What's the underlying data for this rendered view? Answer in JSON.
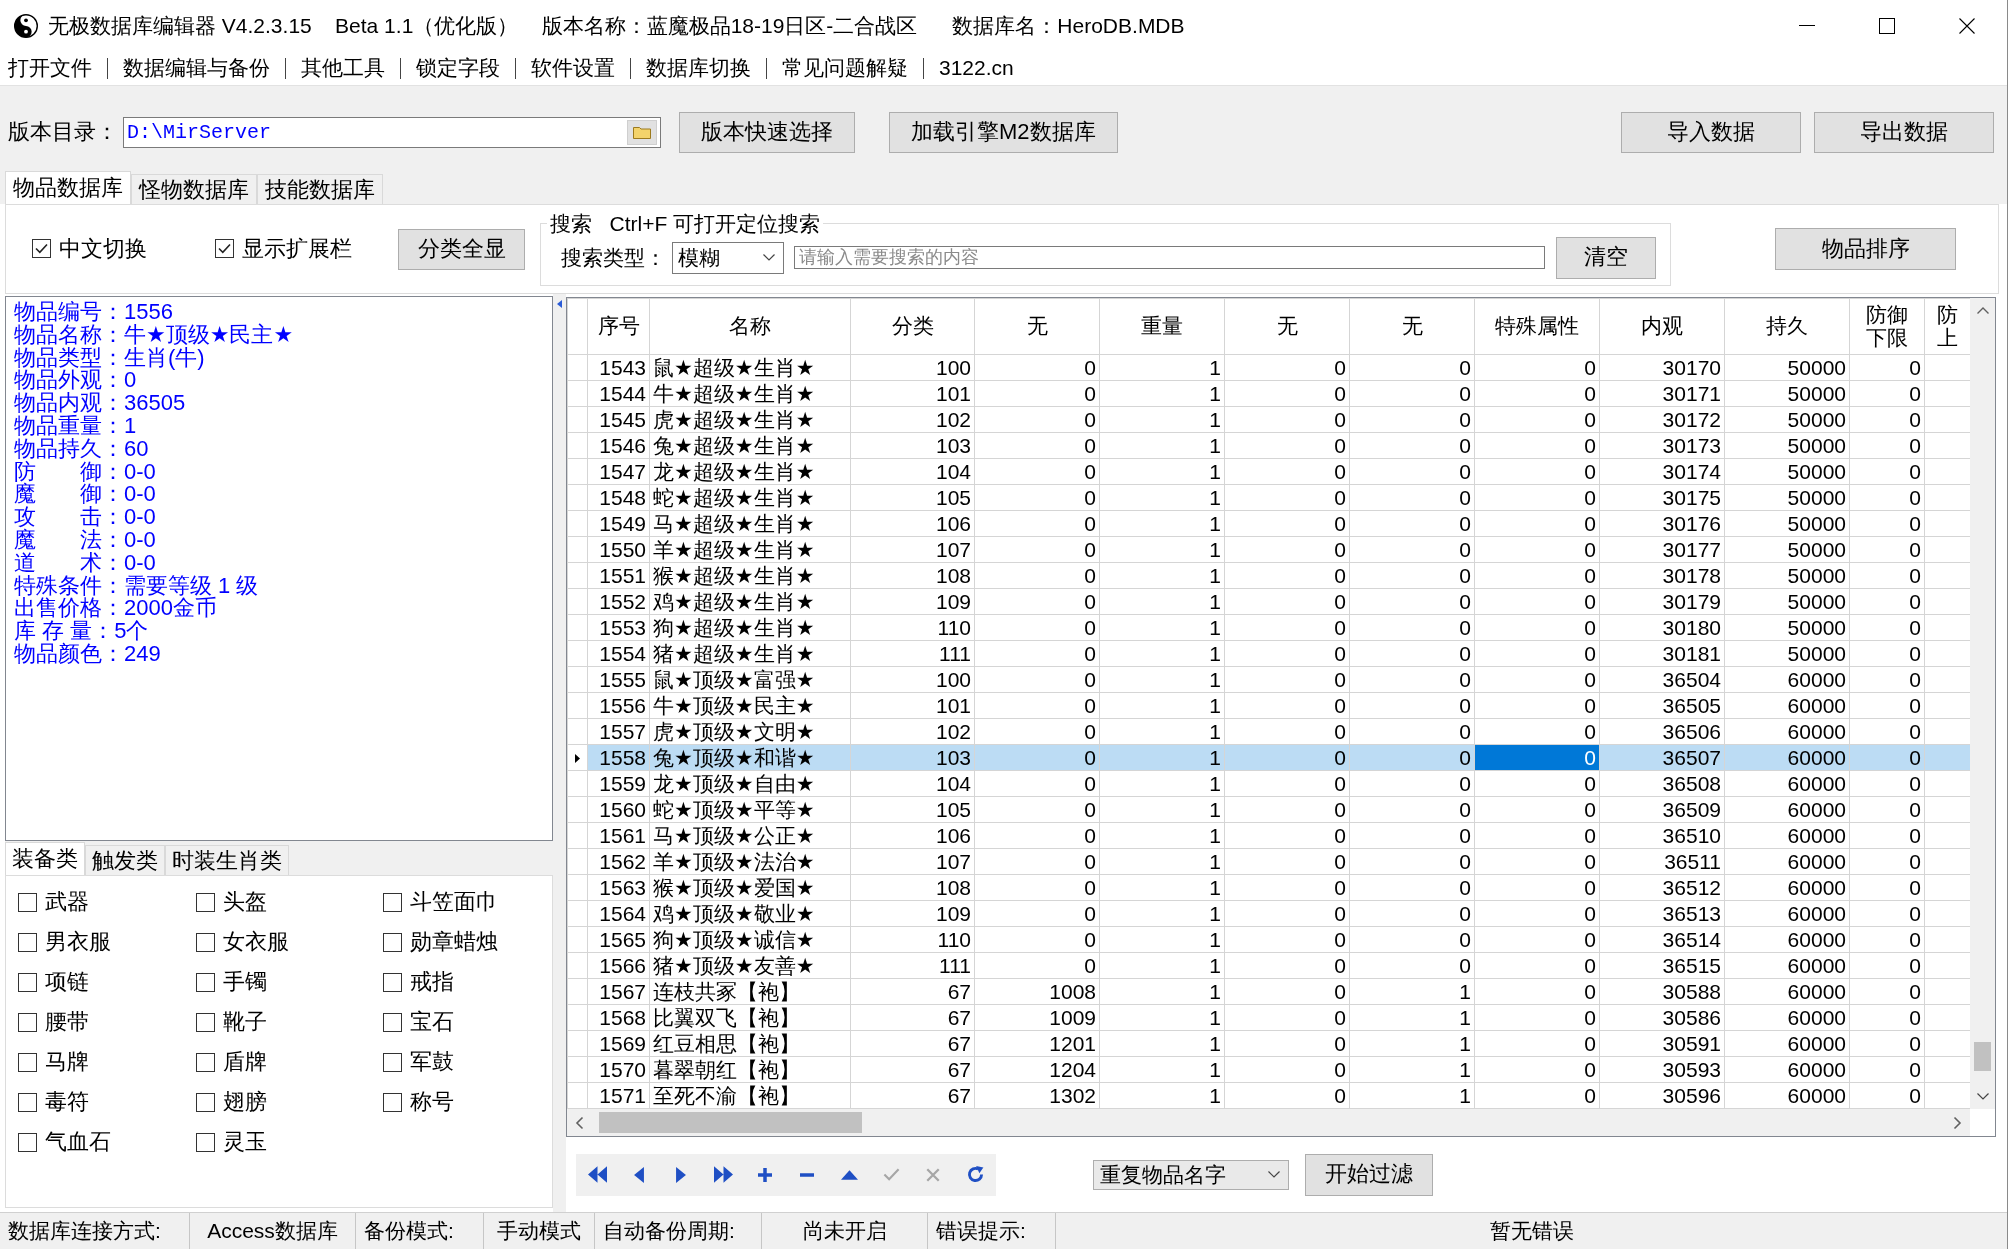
{
  "window": {
    "title": "无极数据库编辑器 V4.2.3.15    Beta 1.1（优化版）    版本名称：蓝魔极品18-19日区-二合战区      数据库名：HeroDB.MDB"
  },
  "menu": [
    "打开文件",
    "数据编辑与备份",
    "其他工具",
    "锁定字段",
    "软件设置",
    "数据库切换",
    "常见问题解疑",
    "3122.cn"
  ],
  "toolbar": {
    "path_label": "版本目录：",
    "path": "D:\\MirServer",
    "left_buttons": [
      "版本快速选择",
      "加载引擎M2数据库"
    ],
    "right_buttons": [
      "导入数据",
      "导出数据"
    ]
  },
  "tabs": [
    {
      "label": "物品数据库",
      "selected": true
    },
    {
      "label": "怪物数据库",
      "selected": false
    },
    {
      "label": "技能数据库",
      "selected": false
    }
  ],
  "options": {
    "checkboxes": [
      {
        "label": "中文切换",
        "checked": true
      },
      {
        "label": "显示扩展栏",
        "checked": true
      }
    ],
    "show_all_button": "分类全显"
  },
  "search": {
    "legend": "搜索   Ctrl+F 可打开定位搜索",
    "type_label": "搜索类型：",
    "type": "模糊",
    "placeholder": "请输入需要搜索的内容",
    "clear_button": "清空"
  },
  "sort_button": "物品排序",
  "details": [
    "物品编号：1556",
    "物品名称：牛★顶级★民主★",
    "物品类型：生肖(牛)",
    "物品外观：0",
    "物品内观：36505",
    "物品重量：1",
    "物品持久：60",
    "防　　御：0-0",
    "魔　　御：0-0",
    "攻　　击：0-0",
    "魔　　法：0-0",
    "道　　术：0-0",
    "特殊条件：需要等级 1 级",
    "出售价格：2000金币",
    "库 存 量：5个",
    "物品颜色：249"
  ],
  "category_tabs": [
    {
      "label": "装备类",
      "selected": true
    },
    {
      "label": "触发类",
      "selected": false
    },
    {
      "label": "时装生肖类",
      "selected": false
    }
  ],
  "categories": [
    {
      "label": "武器",
      "checked": false
    },
    {
      "label": "头盔",
      "checked": false
    },
    {
      "label": "斗笠面巾",
      "checked": false
    },
    {
      "label": "男衣服",
      "checked": false
    },
    {
      "label": "女衣服",
      "checked": false
    },
    {
      "label": "勋章蜡烛",
      "checked": false
    },
    {
      "label": "项链",
      "checked": false
    },
    {
      "label": "手镯",
      "checked": false
    },
    {
      "label": "戒指",
      "checked": false
    },
    {
      "label": "腰带",
      "checked": false
    },
    {
      "label": "靴子",
      "checked": false
    },
    {
      "label": "宝石",
      "checked": false
    },
    {
      "label": "马牌",
      "checked": false
    },
    {
      "label": "盾牌",
      "checked": false
    },
    {
      "label": "军鼓",
      "checked": false
    },
    {
      "label": "毒符",
      "checked": false
    },
    {
      "label": "翅膀",
      "checked": false
    },
    {
      "label": "称号",
      "checked": false
    },
    {
      "label": "气血石",
      "checked": false
    },
    {
      "label": "灵玉",
      "checked": false
    }
  ],
  "table": {
    "columns": [
      {
        "label": "序号",
        "kind": "number",
        "focused": false
      },
      {
        "label": "名称",
        "kind": "text",
        "focused": false
      },
      {
        "label": "分类",
        "kind": "number",
        "focused": false
      },
      {
        "label": "无",
        "kind": "number",
        "focused": false
      },
      {
        "label": "重量",
        "kind": "number",
        "focused": false
      },
      {
        "label": "无",
        "kind": "number",
        "focused": false
      },
      {
        "label": "无",
        "kind": "number",
        "focused": false
      },
      {
        "label": "特殊属性",
        "kind": "number",
        "focused": true
      },
      {
        "label": "内观",
        "kind": "number",
        "focused": false
      },
      {
        "label": "持久",
        "kind": "number",
        "focused": false
      },
      {
        "label": "防御下限",
        "kind": "number",
        "focused": false
      },
      {
        "label": "防上",
        "focused": false
      }
    ],
    "rows": [
      {
        "cells": [
          "1543",
          "鼠★超级★生肖★",
          "100",
          "0",
          "1",
          "0",
          "0",
          "0",
          "30170",
          "50000",
          "0"
        ],
        "selected": false
      },
      {
        "cells": [
          "1544",
          "牛★超级★生肖★",
          "101",
          "0",
          "1",
          "0",
          "0",
          "0",
          "30171",
          "50000",
          "0"
        ],
        "selected": false
      },
      {
        "cells": [
          "1545",
          "虎★超级★生肖★",
          "102",
          "0",
          "1",
          "0",
          "0",
          "0",
          "30172",
          "50000",
          "0"
        ],
        "selected": false
      },
      {
        "cells": [
          "1546",
          "兔★超级★生肖★",
          "103",
          "0",
          "1",
          "0",
          "0",
          "0",
          "30173",
          "50000",
          "0"
        ],
        "selected": false
      },
      {
        "cells": [
          "1547",
          "龙★超级★生肖★",
          "104",
          "0",
          "1",
          "0",
          "0",
          "0",
          "30174",
          "50000",
          "0"
        ],
        "selected": false
      },
      {
        "cells": [
          "1548",
          "蛇★超级★生肖★",
          "105",
          "0",
          "1",
          "0",
          "0",
          "0",
          "30175",
          "50000",
          "0"
        ],
        "selected": false
      },
      {
        "cells": [
          "1549",
          "马★超级★生肖★",
          "106",
          "0",
          "1",
          "0",
          "0",
          "0",
          "30176",
          "50000",
          "0"
        ],
        "selected": false
      },
      {
        "cells": [
          "1550",
          "羊★超级★生肖★",
          "107",
          "0",
          "1",
          "0",
          "0",
          "0",
          "30177",
          "50000",
          "0"
        ],
        "selected": false
      },
      {
        "cells": [
          "1551",
          "猴★超级★生肖★",
          "108",
          "0",
          "1",
          "0",
          "0",
          "0",
          "30178",
          "50000",
          "0"
        ],
        "selected": false
      },
      {
        "cells": [
          "1552",
          "鸡★超级★生肖★",
          "109",
          "0",
          "1",
          "0",
          "0",
          "0",
          "30179",
          "50000",
          "0"
        ],
        "selected": false
      },
      {
        "cells": [
          "1553",
          "狗★超级★生肖★",
          "110",
          "0",
          "1",
          "0",
          "0",
          "0",
          "30180",
          "50000",
          "0"
        ],
        "selected": false
      },
      {
        "cells": [
          "1554",
          "猪★超级★生肖★",
          "111",
          "0",
          "1",
          "0",
          "0",
          "0",
          "30181",
          "50000",
          "0"
        ],
        "selected": false
      },
      {
        "cells": [
          "1555",
          "鼠★顶级★富强★",
          "100",
          "0",
          "1",
          "0",
          "0",
          "0",
          "36504",
          "60000",
          "0"
        ],
        "selected": false
      },
      {
        "cells": [
          "1556",
          "牛★顶级★民主★",
          "101",
          "0",
          "1",
          "0",
          "0",
          "0",
          "36505",
          "60000",
          "0"
        ],
        "selected": false
      },
      {
        "cells": [
          "1557",
          "虎★顶级★文明★",
          "102",
          "0",
          "1",
          "0",
          "0",
          "0",
          "36506",
          "60000",
          "0"
        ],
        "selected": false
      },
      {
        "cells": [
          "1558",
          "兔★顶级★和谐★",
          "103",
          "0",
          "1",
          "0",
          "0",
          "0",
          "36507",
          "60000",
          "0"
        ],
        "selected": true
      },
      {
        "cells": [
          "1559",
          "龙★顶级★自由★",
          "104",
          "0",
          "1",
          "0",
          "0",
          "0",
          "36508",
          "60000",
          "0"
        ],
        "selected": false
      },
      {
        "cells": [
          "1560",
          "蛇★顶级★平等★",
          "105",
          "0",
          "1",
          "0",
          "0",
          "0",
          "36509",
          "60000",
          "0"
        ],
        "selected": false
      },
      {
        "cells": [
          "1561",
          "马★顶级★公正★",
          "106",
          "0",
          "1",
          "0",
          "0",
          "0",
          "36510",
          "60000",
          "0"
        ],
        "selected": false
      },
      {
        "cells": [
          "1562",
          "羊★顶级★法治★",
          "107",
          "0",
          "1",
          "0",
          "0",
          "0",
          "36511",
          "60000",
          "0"
        ],
        "selected": false
      },
      {
        "cells": [
          "1563",
          "猴★顶级★爱国★",
          "108",
          "0",
          "1",
          "0",
          "0",
          "0",
          "36512",
          "60000",
          "0"
        ],
        "selected": false
      },
      {
        "cells": [
          "1564",
          "鸡★顶级★敬业★",
          "109",
          "0",
          "1",
          "0",
          "0",
          "0",
          "36513",
          "60000",
          "0"
        ],
        "selected": false
      },
      {
        "cells": [
          "1565",
          "狗★顶级★诚信★",
          "110",
          "0",
          "1",
          "0",
          "0",
          "0",
          "36514",
          "60000",
          "0"
        ],
        "selected": false
      },
      {
        "cells": [
          "1566",
          "猪★顶级★友善★",
          "111",
          "0",
          "1",
          "0",
          "0",
          "0",
          "36515",
          "60000",
          "0"
        ],
        "selected": false
      },
      {
        "cells": [
          "1567",
          "连枝共冢【袍】",
          "67",
          "1008",
          "1",
          "0",
          "1",
          "0",
          "30588",
          "60000",
          "0"
        ],
        "selected": false
      },
      {
        "cells": [
          "1568",
          "比翼双飞【袍】",
          "67",
          "1009",
          "1",
          "0",
          "1",
          "0",
          "30586",
          "60000",
          "0"
        ],
        "selected": false
      },
      {
        "cells": [
          "1569",
          "红豆相思【袍】",
          "67",
          "1201",
          "1",
          "0",
          "1",
          "0",
          "30591",
          "60000",
          "0"
        ],
        "selected": false
      },
      {
        "cells": [
          "1570",
          "暮翠朝红【袍】",
          "67",
          "1204",
          "1",
          "0",
          "1",
          "0",
          "30593",
          "60000",
          "0"
        ],
        "selected": false
      },
      {
        "cells": [
          "1571",
          "至死不渝【袍】",
          "67",
          "1302",
          "1",
          "0",
          "1",
          "0",
          "30596",
          "60000",
          "0"
        ],
        "selected": false
      }
    ]
  },
  "navigator": [
    {
      "kind": "first",
      "disabled": false
    },
    {
      "kind": "prior",
      "disabled": false
    },
    {
      "kind": "next",
      "disabled": false
    },
    {
      "kind": "last",
      "disabled": false
    },
    {
      "kind": "insert",
      "disabled": false
    },
    {
      "kind": "delete",
      "disabled": false
    },
    {
      "kind": "edit",
      "disabled": false
    },
    {
      "kind": "post",
      "disabled": true
    },
    {
      "kind": "cancel",
      "disabled": true
    },
    {
      "kind": "refresh",
      "disabled": false
    }
  ],
  "filter": {
    "mode": "重复物品名字",
    "button": "开始过滤"
  },
  "status_bar": [
    {
      "text": "数据库连接方式:",
      "kind": "label"
    },
    {
      "text": "Access数据库",
      "kind": "value"
    },
    {
      "text": "备份模式:",
      "kind": "label"
    },
    {
      "text": "手动模式",
      "kind": "value"
    },
    {
      "text": "自动备份周期:",
      "kind": "label"
    },
    {
      "text": "尚未开启",
      "kind": "value"
    },
    {
      "text": "错误提示:",
      "kind": "label"
    },
    {
      "text": "暂无错误",
      "kind": "value"
    }
  ]
}
